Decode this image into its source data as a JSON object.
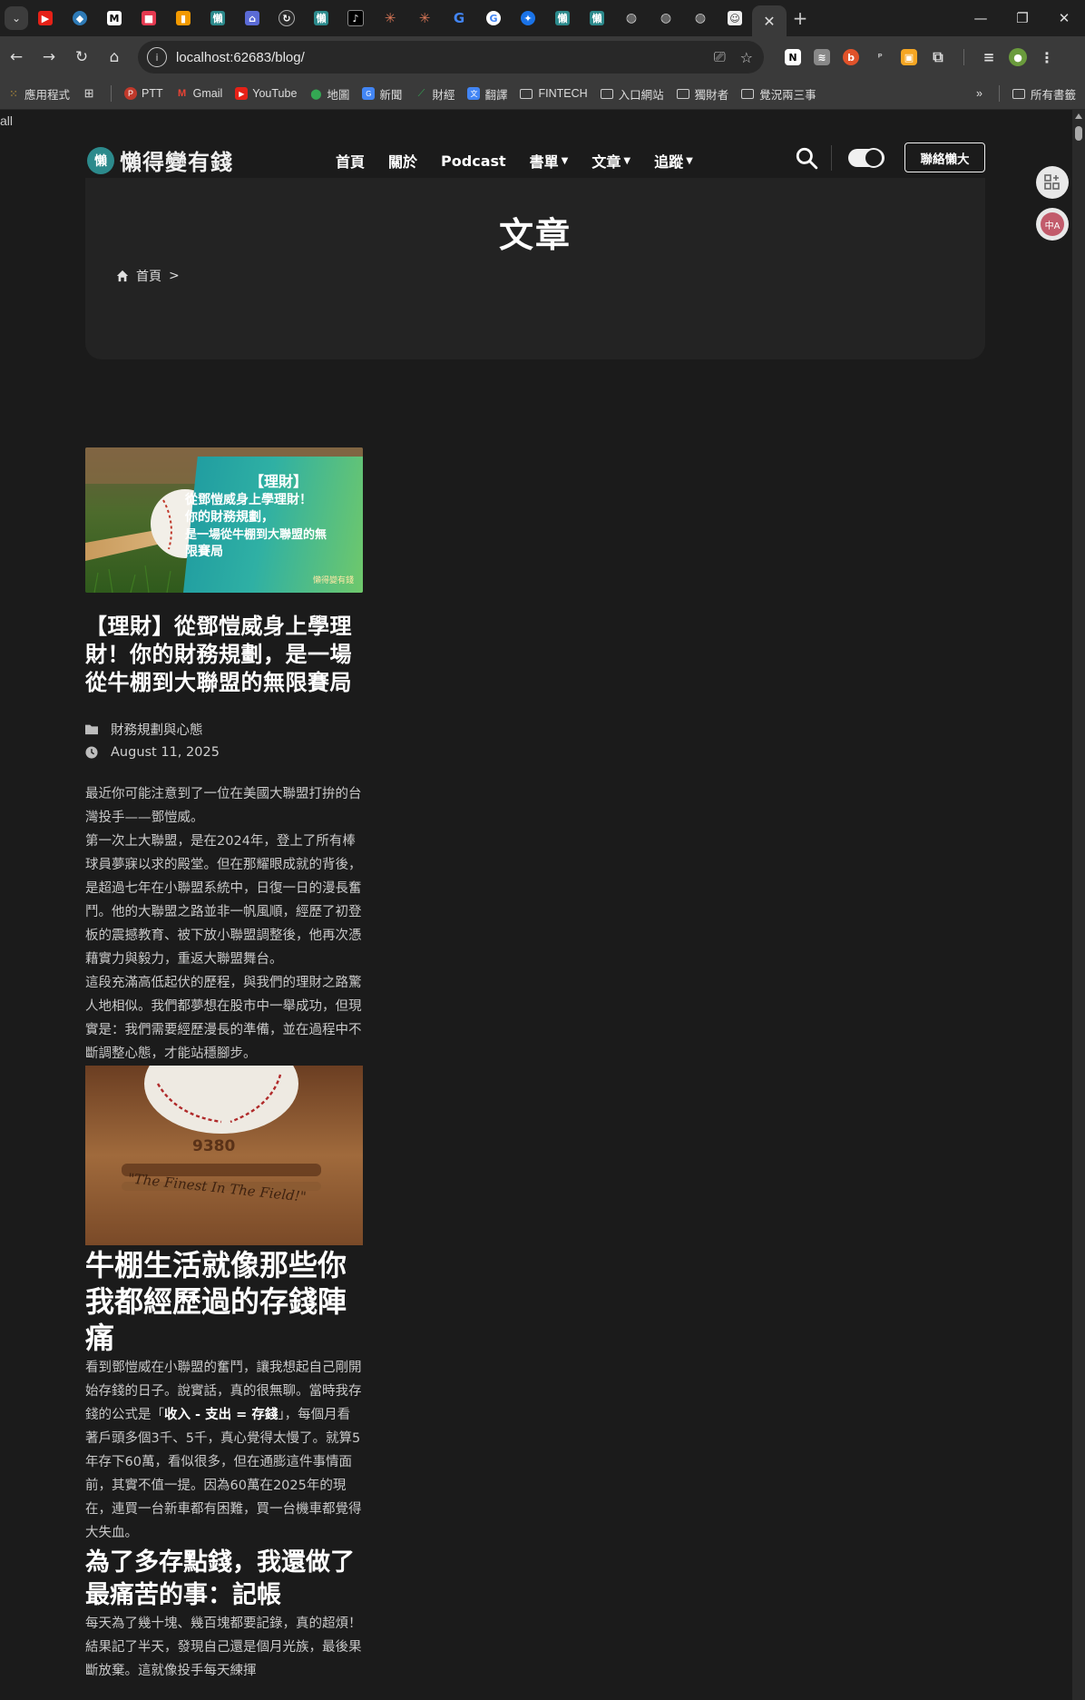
{
  "browser": {
    "url": "localhost:62683/blog/",
    "tabs_favicons": [
      "youtube-icon",
      "ufo-icon",
      "medium-icon",
      "bookmark-icon",
      "analytics-icon",
      "site-icon",
      "cart-icon",
      "refresh-icon",
      "site-icon",
      "tiktok-icon",
      "claude-icon",
      "claude-icon",
      "google-icon",
      "google-icon",
      "ai-icon",
      "site-icon",
      "site-icon",
      "globe-icon",
      "globe-icon",
      "globe-icon",
      "avatar-icon"
    ],
    "bookmarks": [
      {
        "label": "應用程式",
        "icon": "apps-icon"
      },
      {
        "label": "PTT",
        "icon": "ptt-icon"
      },
      {
        "label": "Gmail",
        "icon": "gmail-icon"
      },
      {
        "label": "YouTube",
        "icon": "youtube-icon"
      },
      {
        "label": "地圖",
        "icon": "maps-icon"
      },
      {
        "label": "新聞",
        "icon": "news-icon"
      },
      {
        "label": "財經",
        "icon": "finance-icon"
      },
      {
        "label": "翻譯",
        "icon": "translate-icon"
      },
      {
        "label": "FINTECH",
        "icon": "folder-icon"
      },
      {
        "label": "入口網站",
        "icon": "folder-icon"
      },
      {
        "label": "獨財者",
        "icon": "folder-icon"
      },
      {
        "label": "覺況兩三事",
        "icon": "folder-icon"
      }
    ],
    "all_bookmarks": "所有書籤"
  },
  "page": {
    "stray_text": "all",
    "site": {
      "logo_badge": "懶",
      "logo_text": "懶得變有錢",
      "nav": [
        {
          "label": "首頁",
          "dropdown": false
        },
        {
          "label": "關於",
          "dropdown": false
        },
        {
          "label": "Podcast",
          "dropdown": false
        },
        {
          "label": "書單",
          "dropdown": true
        },
        {
          "label": "文章",
          "dropdown": true
        },
        {
          "label": "追蹤",
          "dropdown": true
        }
      ],
      "contact_label": "聯絡懶大"
    },
    "hero": {
      "title": "文章",
      "breadcrumb_home": "首頁",
      "breadcrumb_sep": ">"
    },
    "post": {
      "thumb_tag": "【理財】",
      "thumb_lines": [
        "從鄧愷威身上學理財！",
        "你的財務規劃，",
        "是一場從牛棚到大聯盟的無",
        "限賽局"
      ],
      "thumb_logo": "懶得變有錢",
      "title": "【理財】從鄧愷威身上學理財！你的財務規劃，是一場從牛棚到大聯盟的無限賽局",
      "category": "財務規劃與心態",
      "date": "August 11, 2025",
      "excerpt": [
        "最近你可能注意到了一位在美國大聯盟打拚的台灣投手——鄧愷威。",
        "第一次上大聯盟，是在2024年，登上了所有棒球員夢寐以求的殿堂。但在那耀眼成就的背後，是超過七年在小聯盟系統中，日復一日的漫長奮鬥。他的大聯盟之路並非一帆風順，經歷了初登板的震撼教育、被下放小聯盟調整後，他再次憑藉實力與毅力，重返大聯盟舞台。",
        "這段充滿高低起伏的歷程，與我們的理財之路驚人地相似。我們都夢想在股市中一舉成功，但現實是：我們需要經歷漫長的準備，並在過程中不斷調整心態，才能站穩腳步。"
      ],
      "glove_text": "\"The Finest In The Field!\"",
      "glove_number": "9380",
      "h2": "牛棚生活就像那些你我都經歷過的存錢陣痛",
      "p2_before": "看到鄧愷威在小聯盟的奮鬥，讓我想起自己剛開始存錢的日子。說實話，真的很無聊。當時我存錢的公式是「",
      "p2_bold": "收入 - 支出 = 存錢",
      "p2_after": "」，每個月看著戶頭多個3千、5千，真心覺得太慢了。就算5年存下60萬，看似很多，但在通膨這件事情面前，其實不值一提。因為60萬在2025年的現在，連買一台新車都有困難，買一台機車都覺得大失血。",
      "h3": "為了多存點錢，我還做了最痛苦的事：記帳",
      "p3": "每天為了幾十塊、幾百塊都要記錄，真的超煩！結果記了半天，發現自己還是個月光族，最後果斷放棄。這就像投手每天練揮"
    }
  }
}
